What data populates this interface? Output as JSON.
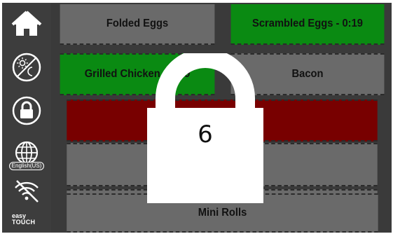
{
  "sidebar": {
    "language": "English(US)",
    "brand_line1": "easy",
    "brand_line2": "TOUCH"
  },
  "tiles": [
    {
      "label": "Folded Eggs",
      "state": "normal"
    },
    {
      "label": "Scrambled Eggs - 0:19",
      "state": "active"
    },
    {
      "label": "Grilled Chicken - 0:29",
      "state": "active"
    },
    {
      "label": "Bacon",
      "state": "normal"
    },
    {
      "label": "",
      "state": "alarm"
    },
    {
      "label": "",
      "state": "empty"
    },
    {
      "label": "",
      "state": "empty"
    },
    {
      "label": "Mini Rolls",
      "state": "normal"
    }
  ],
  "lock_overlay": {
    "value": "6"
  },
  "colors": {
    "active": "#0a8a12",
    "alarm": "#780000",
    "normal": "#6a6a6a",
    "sidebar": "#3d3d3d"
  }
}
